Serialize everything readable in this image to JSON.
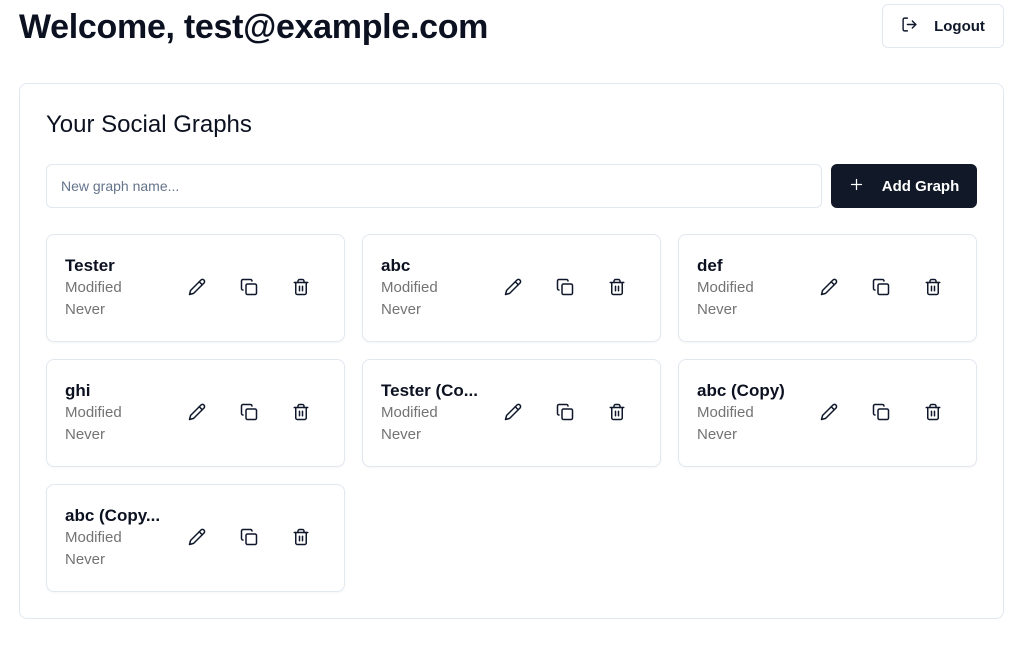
{
  "header": {
    "welcome": "Welcome, test@example.com",
    "logout_label": "Logout"
  },
  "panel": {
    "title": "Your Social Graphs",
    "input_placeholder": "New graph name...",
    "input_value": "",
    "add_label": "Add Graph"
  },
  "graphs": [
    {
      "name": "Tester",
      "modified_label": "Modified",
      "modified_value": "Never"
    },
    {
      "name": "abc",
      "modified_label": "Modified",
      "modified_value": "Never"
    },
    {
      "name": "def",
      "modified_label": "Modified",
      "modified_value": "Never"
    },
    {
      "name": "ghi",
      "modified_label": "Modified",
      "modified_value": "Never"
    },
    {
      "name": "Tester (Co...",
      "modified_label": "Modified",
      "modified_value": "Never"
    },
    {
      "name": "abc (Copy)",
      "modified_label": "Modified",
      "modified_value": "Never"
    },
    {
      "name": "abc (Copy...",
      "modified_label": "Modified",
      "modified_value": "Never"
    }
  ],
  "icons": {
    "logout": "logout-icon",
    "add": "plus-icon",
    "edit": "pencil-icon",
    "duplicate": "copy-icon",
    "delete": "trash-icon"
  },
  "colors": {
    "primary_button": "#111827",
    "border": "#e2e8f0",
    "muted_text": "#737373"
  }
}
